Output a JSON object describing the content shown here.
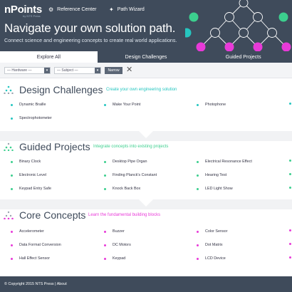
{
  "brand": {
    "logo": "nPoints",
    "logo_sub": "by NTS Press"
  },
  "nav": {
    "reference_center": "Reference Center",
    "path_wizard": "Path Wizard"
  },
  "hero": {
    "title": "Navigate your own solution path.",
    "subtitle": "Connect science and engineering concepts to create real world applications."
  },
  "tabs": [
    "Explore All",
    "Design Challenges",
    "Guided Projects"
  ],
  "filters": {
    "hardware": "— Hardware —",
    "subject": "— Subject —",
    "narrow": "Narrow"
  },
  "colors": {
    "header": "#3f4b5b",
    "teal": "#26c6c0",
    "green": "#3ccf8e",
    "magenta": "#e83ad8"
  },
  "sections": {
    "design": {
      "title": "Design Challenges",
      "tagline": "Create your own engineering solution",
      "items": [
        "Dynamic Braille",
        "Make Your Point",
        "Photophone",
        "Spectrophotometer"
      ]
    },
    "guided": {
      "title": "Guided Projects",
      "tagline": "Integrate concepts into existing projects",
      "items": [
        "Binary Clock",
        "Desktop Pipe Organ",
        "Electrical Resonance Effect",
        "Electronic Level",
        "Finding Planck's Constant",
        "Hearing Test",
        "Keypad Entry Safe",
        "Knock Back Box",
        "LED Light Show"
      ]
    },
    "core": {
      "title": "Core Concepts",
      "tagline": "Learn the fundamental building blocks",
      "items": [
        "Accelerometer",
        "Buzzer",
        "Color Sensor",
        "Data Format Conversion",
        "DC Motors",
        "Dot Matrix",
        "Hall Effect Sensor",
        "Keypad",
        "LCD Device"
      ]
    }
  },
  "footer": {
    "copyright": "© Copyright 2015 NTS Press",
    "separator": "|",
    "about": "About"
  }
}
